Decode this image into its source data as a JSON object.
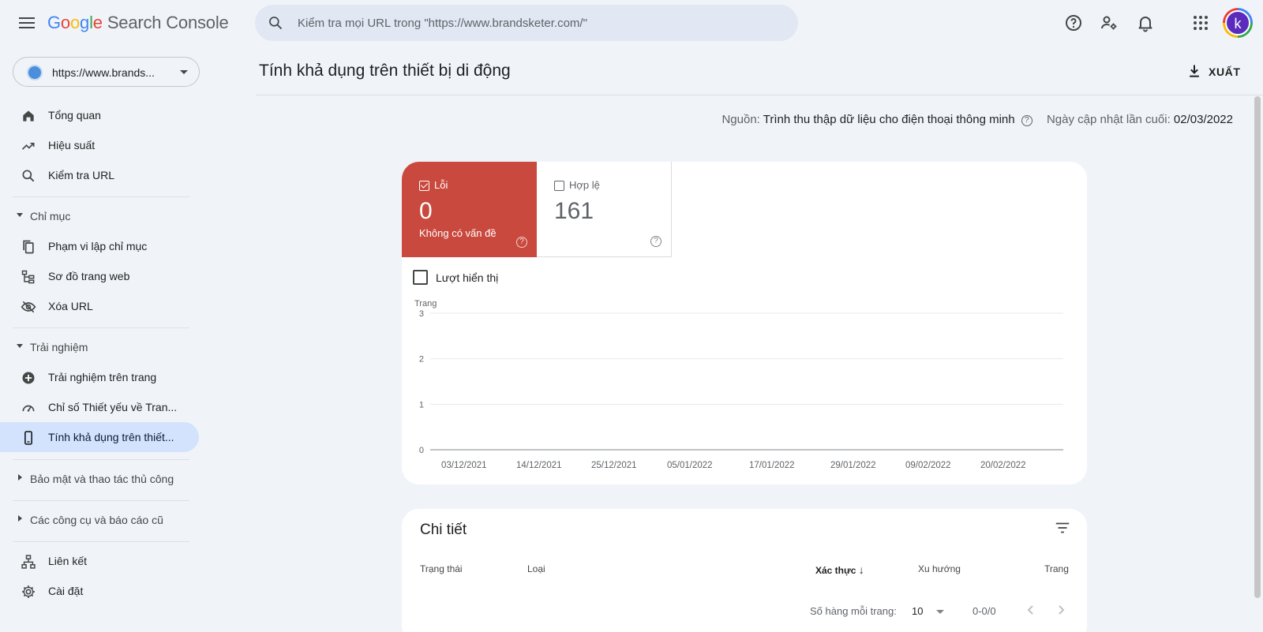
{
  "app": {
    "logo_letters": [
      "G",
      "o",
      "o",
      "g",
      "l",
      "e"
    ],
    "product_name": "Search Console"
  },
  "search": {
    "placeholder": "Kiểm tra mọi URL trong \"https://www.brandsketer.com/\""
  },
  "header_icons": [
    "help-icon",
    "manage-users-icon",
    "notifications-icon",
    "apps-grid-icon"
  ],
  "avatar": {
    "letter": "k"
  },
  "property": {
    "label": "https://www.brands..."
  },
  "sidebar": {
    "top_items": [
      {
        "label": "Tổng quan",
        "icon": "home-icon"
      },
      {
        "label": "Hiệu suất",
        "icon": "trending-up-icon"
      },
      {
        "label": "Kiểm tra URL",
        "icon": "search-icon"
      }
    ],
    "index_section": {
      "label": "Chỉ mục",
      "items": [
        {
          "label": "Phạm vi lập chỉ mục",
          "icon": "file-copy-icon"
        },
        {
          "label": "Sơ đồ trang web",
          "icon": "sitemap-icon"
        },
        {
          "label": "Xóa URL",
          "icon": "visibility-off-icon"
        }
      ]
    },
    "experience_section": {
      "label": "Trải nghiệm",
      "items": [
        {
          "label": "Trải nghiệm trên trang",
          "icon": "add-circle-icon"
        },
        {
          "label": "Chỉ số Thiết yếu về Tran...",
          "icon": "speed-icon"
        },
        {
          "label": "Tính khả dụng trên thiết...",
          "icon": "smartphone-icon",
          "active": true
        }
      ]
    },
    "security_section": {
      "label": "Bảo mật và thao tác thủ công"
    },
    "legacy_section": {
      "label": "Các công cụ và báo cáo cũ"
    },
    "bottom_items": [
      {
        "label": "Liên kết",
        "icon": "links-icon"
      },
      {
        "label": "Cài đặt",
        "icon": "settings-icon"
      }
    ]
  },
  "page": {
    "title": "Tính khả dụng trên thiết bị di động",
    "export_label": "XUẤT",
    "source_label": "Nguồn:",
    "source_value": "Trình thu thập dữ liệu cho điện thoại thông minh",
    "updated_label": "Ngày cập nhật lần cuối:",
    "updated_value": "02/03/2022"
  },
  "tiles": {
    "error": {
      "label": "Lỗi",
      "value": "0",
      "subtitle": "Không có vấn đề",
      "checked": true,
      "color": "#c9493e"
    },
    "valid": {
      "label": "Hợp lệ",
      "value": "161",
      "checked": false
    }
  },
  "impressions_checkbox": {
    "label": "Lượt hiển thị",
    "checked": false
  },
  "chart_data": {
    "type": "line",
    "ylabel": "Trang",
    "ylim": [
      0,
      3
    ],
    "yticks": [
      0,
      1,
      2,
      3
    ],
    "x_ticks": [
      "03/12/2021",
      "14/12/2021",
      "25/12/2021",
      "05/01/2022",
      "17/01/2022",
      "29/01/2022",
      "09/02/2022",
      "20/02/2022"
    ],
    "x_range": [
      "2021-12-03",
      "2022-03-02"
    ],
    "series": [
      {
        "values": [
          0,
          0,
          0,
          0,
          0,
          0,
          0,
          0
        ]
      }
    ],
    "grid": true
  },
  "details": {
    "title": "Chi tiết",
    "columns": [
      "Trạng thái",
      "Loại",
      "Xác thực",
      "Xu hướng",
      "Trang"
    ],
    "sorted_column": "Xác thực",
    "rows_per_page_label": "Số hàng mỗi trang:",
    "rows_per_page": "10",
    "range": "0-0/0"
  }
}
